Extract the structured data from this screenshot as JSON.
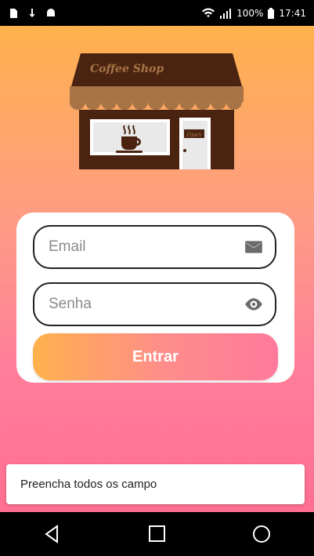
{
  "status_bar": {
    "battery": "100%",
    "time": "17:41"
  },
  "logo": {
    "sign_text": "Coffee Shop",
    "door_sign": "Open"
  },
  "login": {
    "email_placeholder": "Email",
    "password_placeholder": "Senha",
    "submit_label": "Entrar"
  },
  "toast": {
    "message": "Preencha todos os campo"
  },
  "colors": {
    "gradient_top": "#FFB14D",
    "gradient_bottom": "#FF6F92",
    "shop_brown": "#4A2410",
    "awning_tan": "#A87446"
  },
  "nav": {
    "icons": [
      "back-icon",
      "home-icon",
      "recents-icon"
    ]
  }
}
